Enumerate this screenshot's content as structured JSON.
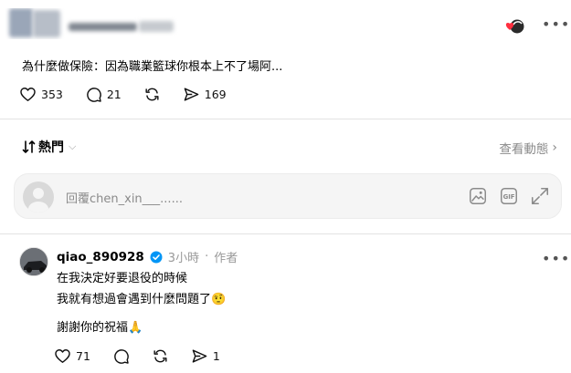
{
  "post": {
    "text": "為什麼做保險：因為職業籃球你根本上不了場阿...",
    "likes": "353",
    "comments": "21",
    "shares": "169"
  },
  "sort": {
    "label": "熱門"
  },
  "view_activity": "查看動態",
  "reply": {
    "placeholder": "回覆chen_xin___......"
  },
  "comment": {
    "username": "qiao_890928",
    "time": "3小時",
    "role": "作者",
    "line1": "在我決定好要退役的時候",
    "line2": "我就有想過會遇到什麼問題了🤨",
    "line3": "謝謝你的祝福🙏",
    "likes": "71",
    "shares": "1"
  },
  "colors": {
    "verified": "#0095f6",
    "heart": "#ff3040"
  }
}
